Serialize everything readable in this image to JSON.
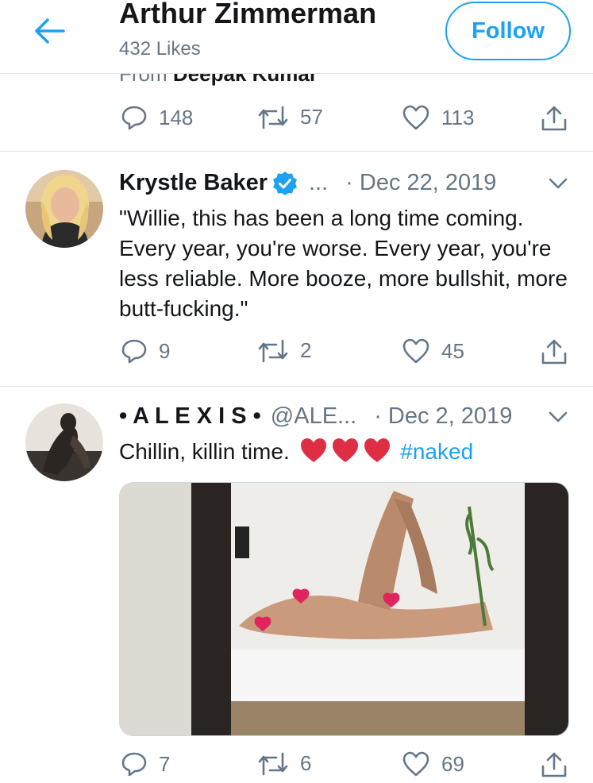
{
  "header": {
    "title": "Arthur Zimmerman",
    "subtitle": "432 Likes",
    "follow_label": "Follow",
    "back_icon": "arrow-left-icon"
  },
  "clipped_tweet": {
    "from_label": "From",
    "from_name": "Deepak Kumar",
    "replies": "148",
    "retweets": "57",
    "likes": "113"
  },
  "tweets": [
    {
      "name": "Krystle Baker",
      "verified": true,
      "handle": "...",
      "date": "· Dec 22, 2019",
      "text": "\"Willie, this has been a long time coming. Every year, you're worse. Every year, you're less reliable. More booze, more bullshit, more butt-fucking.\"",
      "replies": "9",
      "retweets": "2",
      "likes": "45"
    },
    {
      "name": "• A L E X I S •",
      "handle": "@ALE...",
      "date": "· Dec 2, 2019",
      "text": "Chillin, killin time.",
      "emoji": "❤️❤️❤️",
      "hashtag": "#naked",
      "replies": "7",
      "retweets": "6",
      "likes": "69"
    }
  ],
  "colors": {
    "accent": "#1da1f2",
    "secondary_text": "#657786",
    "divider": "#dfe4e8",
    "heart": "#e0245e"
  }
}
